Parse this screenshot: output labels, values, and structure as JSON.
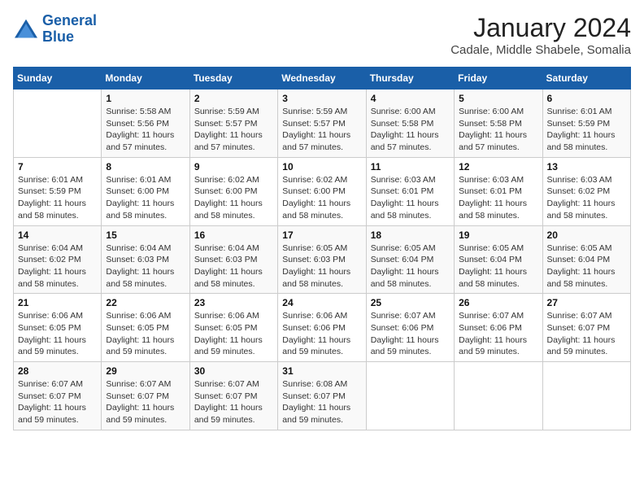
{
  "logo": {
    "line1": "General",
    "line2": "Blue"
  },
  "title": "January 2024",
  "subtitle": "Cadale, Middle Shabele, Somalia",
  "weekdays": [
    "Sunday",
    "Monday",
    "Tuesday",
    "Wednesday",
    "Thursday",
    "Friday",
    "Saturday"
  ],
  "weeks": [
    [
      {
        "day": "",
        "sunrise": "",
        "sunset": "",
        "daylight": ""
      },
      {
        "day": "1",
        "sunrise": "Sunrise: 5:58 AM",
        "sunset": "Sunset: 5:56 PM",
        "daylight": "Daylight: 11 hours and 57 minutes."
      },
      {
        "day": "2",
        "sunrise": "Sunrise: 5:59 AM",
        "sunset": "Sunset: 5:57 PM",
        "daylight": "Daylight: 11 hours and 57 minutes."
      },
      {
        "day": "3",
        "sunrise": "Sunrise: 5:59 AM",
        "sunset": "Sunset: 5:57 PM",
        "daylight": "Daylight: 11 hours and 57 minutes."
      },
      {
        "day": "4",
        "sunrise": "Sunrise: 6:00 AM",
        "sunset": "Sunset: 5:58 PM",
        "daylight": "Daylight: 11 hours and 57 minutes."
      },
      {
        "day": "5",
        "sunrise": "Sunrise: 6:00 AM",
        "sunset": "Sunset: 5:58 PM",
        "daylight": "Daylight: 11 hours and 57 minutes."
      },
      {
        "day": "6",
        "sunrise": "Sunrise: 6:01 AM",
        "sunset": "Sunset: 5:59 PM",
        "daylight": "Daylight: 11 hours and 58 minutes."
      }
    ],
    [
      {
        "day": "7",
        "sunrise": "Sunrise: 6:01 AM",
        "sunset": "Sunset: 5:59 PM",
        "daylight": "Daylight: 11 hours and 58 minutes."
      },
      {
        "day": "8",
        "sunrise": "Sunrise: 6:01 AM",
        "sunset": "Sunset: 6:00 PM",
        "daylight": "Daylight: 11 hours and 58 minutes."
      },
      {
        "day": "9",
        "sunrise": "Sunrise: 6:02 AM",
        "sunset": "Sunset: 6:00 PM",
        "daylight": "Daylight: 11 hours and 58 minutes."
      },
      {
        "day": "10",
        "sunrise": "Sunrise: 6:02 AM",
        "sunset": "Sunset: 6:00 PM",
        "daylight": "Daylight: 11 hours and 58 minutes."
      },
      {
        "day": "11",
        "sunrise": "Sunrise: 6:03 AM",
        "sunset": "Sunset: 6:01 PM",
        "daylight": "Daylight: 11 hours and 58 minutes."
      },
      {
        "day": "12",
        "sunrise": "Sunrise: 6:03 AM",
        "sunset": "Sunset: 6:01 PM",
        "daylight": "Daylight: 11 hours and 58 minutes."
      },
      {
        "day": "13",
        "sunrise": "Sunrise: 6:03 AM",
        "sunset": "Sunset: 6:02 PM",
        "daylight": "Daylight: 11 hours and 58 minutes."
      }
    ],
    [
      {
        "day": "14",
        "sunrise": "Sunrise: 6:04 AM",
        "sunset": "Sunset: 6:02 PM",
        "daylight": "Daylight: 11 hours and 58 minutes."
      },
      {
        "day": "15",
        "sunrise": "Sunrise: 6:04 AM",
        "sunset": "Sunset: 6:03 PM",
        "daylight": "Daylight: 11 hours and 58 minutes."
      },
      {
        "day": "16",
        "sunrise": "Sunrise: 6:04 AM",
        "sunset": "Sunset: 6:03 PM",
        "daylight": "Daylight: 11 hours and 58 minutes."
      },
      {
        "day": "17",
        "sunrise": "Sunrise: 6:05 AM",
        "sunset": "Sunset: 6:03 PM",
        "daylight": "Daylight: 11 hours and 58 minutes."
      },
      {
        "day": "18",
        "sunrise": "Sunrise: 6:05 AM",
        "sunset": "Sunset: 6:04 PM",
        "daylight": "Daylight: 11 hours and 58 minutes."
      },
      {
        "day": "19",
        "sunrise": "Sunrise: 6:05 AM",
        "sunset": "Sunset: 6:04 PM",
        "daylight": "Daylight: 11 hours and 58 minutes."
      },
      {
        "day": "20",
        "sunrise": "Sunrise: 6:05 AM",
        "sunset": "Sunset: 6:04 PM",
        "daylight": "Daylight: 11 hours and 58 minutes."
      }
    ],
    [
      {
        "day": "21",
        "sunrise": "Sunrise: 6:06 AM",
        "sunset": "Sunset: 6:05 PM",
        "daylight": "Daylight: 11 hours and 59 minutes."
      },
      {
        "day": "22",
        "sunrise": "Sunrise: 6:06 AM",
        "sunset": "Sunset: 6:05 PM",
        "daylight": "Daylight: 11 hours and 59 minutes."
      },
      {
        "day": "23",
        "sunrise": "Sunrise: 6:06 AM",
        "sunset": "Sunset: 6:05 PM",
        "daylight": "Daylight: 11 hours and 59 minutes."
      },
      {
        "day": "24",
        "sunrise": "Sunrise: 6:06 AM",
        "sunset": "Sunset: 6:06 PM",
        "daylight": "Daylight: 11 hours and 59 minutes."
      },
      {
        "day": "25",
        "sunrise": "Sunrise: 6:07 AM",
        "sunset": "Sunset: 6:06 PM",
        "daylight": "Daylight: 11 hours and 59 minutes."
      },
      {
        "day": "26",
        "sunrise": "Sunrise: 6:07 AM",
        "sunset": "Sunset: 6:06 PM",
        "daylight": "Daylight: 11 hours and 59 minutes."
      },
      {
        "day": "27",
        "sunrise": "Sunrise: 6:07 AM",
        "sunset": "Sunset: 6:07 PM",
        "daylight": "Daylight: 11 hours and 59 minutes."
      }
    ],
    [
      {
        "day": "28",
        "sunrise": "Sunrise: 6:07 AM",
        "sunset": "Sunset: 6:07 PM",
        "daylight": "Daylight: 11 hours and 59 minutes."
      },
      {
        "day": "29",
        "sunrise": "Sunrise: 6:07 AM",
        "sunset": "Sunset: 6:07 PM",
        "daylight": "Daylight: 11 hours and 59 minutes."
      },
      {
        "day": "30",
        "sunrise": "Sunrise: 6:07 AM",
        "sunset": "Sunset: 6:07 PM",
        "daylight": "Daylight: 11 hours and 59 minutes."
      },
      {
        "day": "31",
        "sunrise": "Sunrise: 6:08 AM",
        "sunset": "Sunset: 6:07 PM",
        "daylight": "Daylight: 11 hours and 59 minutes."
      },
      {
        "day": "",
        "sunrise": "",
        "sunset": "",
        "daylight": ""
      },
      {
        "day": "",
        "sunrise": "",
        "sunset": "",
        "daylight": ""
      },
      {
        "day": "",
        "sunrise": "",
        "sunset": "",
        "daylight": ""
      }
    ]
  ]
}
